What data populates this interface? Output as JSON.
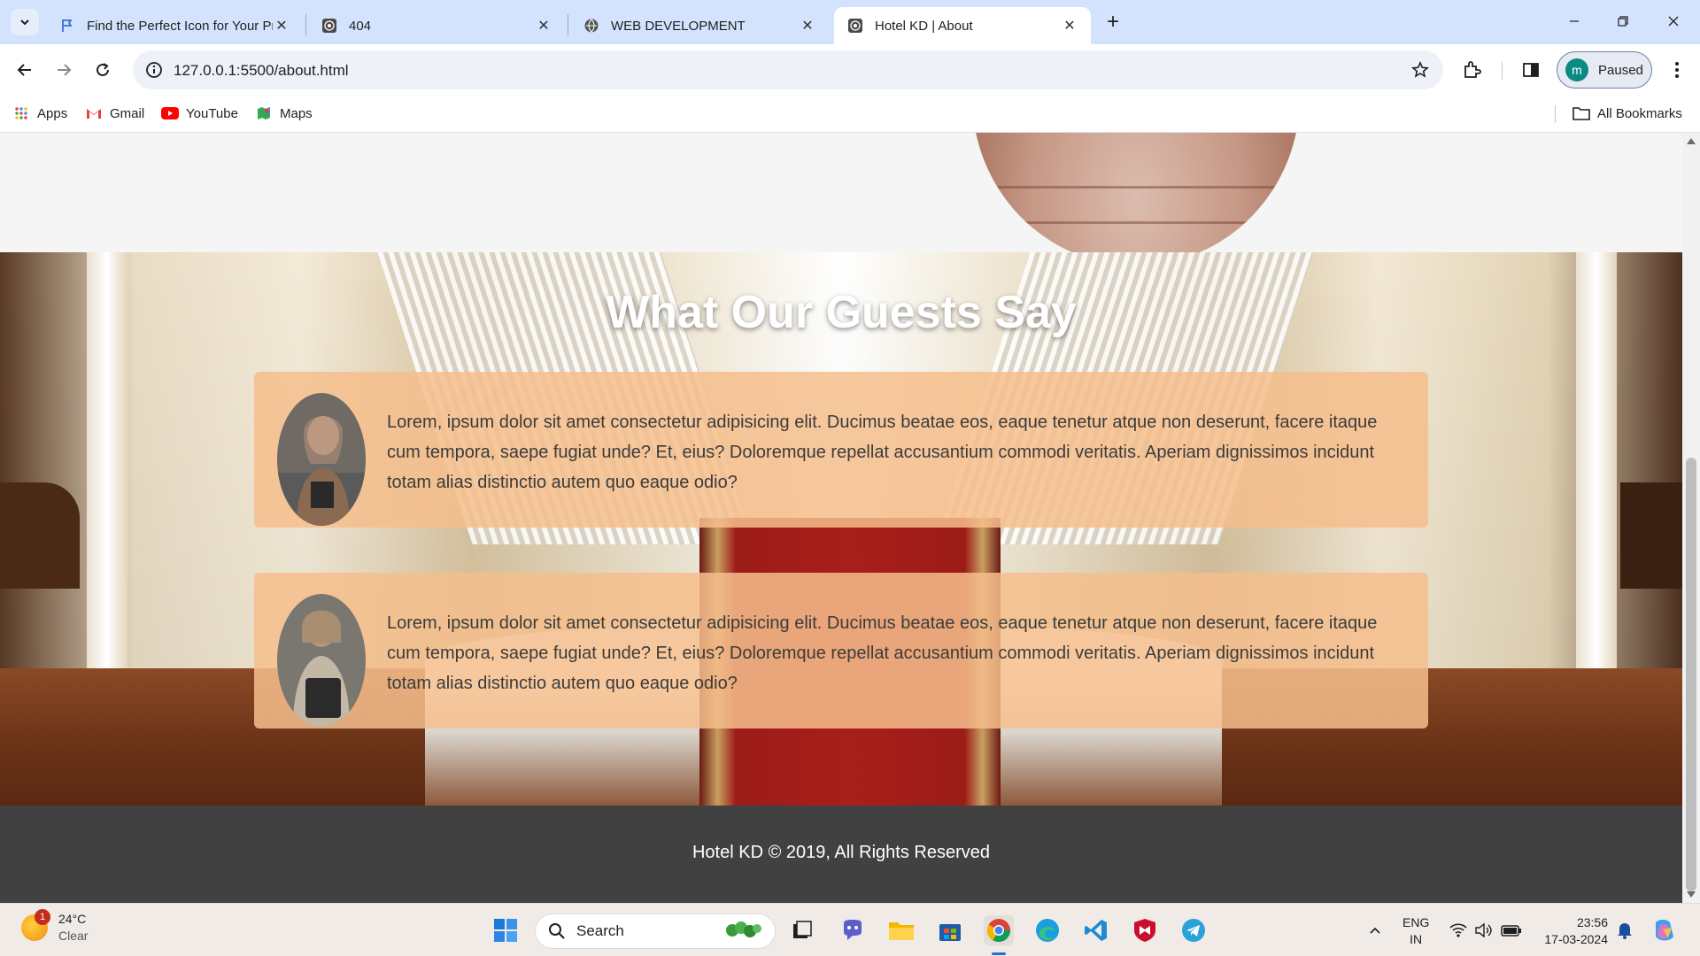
{
  "browser": {
    "tabs": [
      {
        "title": "Find the Perfect Icon for Your Pr",
        "favicon": "flag-icon",
        "active": false
      },
      {
        "title": "404",
        "favicon": "podcast-icon",
        "active": false
      },
      {
        "title": "WEB DEVELOPMENT",
        "favicon": "globe-icon",
        "active": false
      },
      {
        "title": "Hotel KD | About",
        "favicon": "podcast-icon",
        "active": true
      }
    ],
    "url": "127.0.0.1:5500/about.html",
    "profile_initial": "m",
    "profile_status": "Paused",
    "bookmarks": [
      {
        "label": "Apps",
        "icon": "apps-grid-icon"
      },
      {
        "label": "Gmail",
        "icon": "gmail-icon"
      },
      {
        "label": "YouTube",
        "icon": "youtube-icon"
      },
      {
        "label": "Maps",
        "icon": "maps-icon"
      }
    ],
    "all_bookmarks": "All Bookmarks"
  },
  "page": {
    "testimonials_title": "What Our Guests Say",
    "testimonials": [
      {
        "text": "Lorem, ipsum dolor sit amet consectetur adipisicing elit. Ducimus beatae eos, eaque tenetur atque non deserunt, facere itaque cum tempora, saepe fugiat unde? Et, eius? Doloremque repellat accusantium commodi veritatis. Aperiam dignissimos incidunt totam alias distinctio autem quo eaque odio?"
      },
      {
        "text": "Lorem, ipsum dolor sit amet consectetur adipisicing elit. Ducimus beatae eos, eaque tenetur atque non deserunt, facere itaque cum tempora, saepe fugiat unde? Et, eius? Doloremque repellat accusantium commodi veritatis. Aperiam dignissimos incidunt totam alias distinctio autem quo eaque odio?"
      }
    ],
    "footer": "Hotel KD © 2019, All Rights Reserved"
  },
  "taskbar": {
    "weather_temp": "24°C",
    "weather_cond": "Clear",
    "weather_badge": "1",
    "search_label": "Search",
    "lang_line1": "ENG",
    "lang_line2": "IN",
    "time": "23:56",
    "date": "17-03-2024"
  },
  "colors": {
    "card_bg": "#f6be8c",
    "footer_bg": "#414141",
    "tabbar_bg": "#d3e3fd"
  }
}
